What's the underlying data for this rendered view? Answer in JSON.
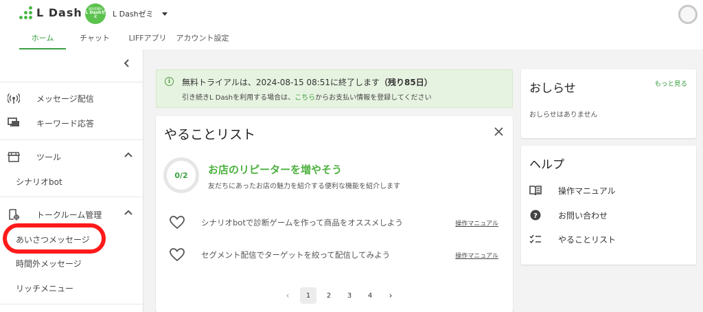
{
  "header": {
    "logo_text": "L Dash",
    "account": {
      "avatar_line1": "部田会場の",
      "avatar_line2": "L Dashゼミ",
      "name": "L Dashゼミ"
    },
    "tabs": [
      {
        "label": "ホーム",
        "active": true
      },
      {
        "label": "チャット",
        "active": false
      },
      {
        "label": "LIFFアプリ",
        "active": false
      },
      {
        "label": "アカウント設定",
        "active": false
      }
    ]
  },
  "sidebar": {
    "collapse_icon": "chevron-left-icon",
    "items": [
      {
        "label": "メッセージ配信",
        "icon": "broadcast-icon"
      },
      {
        "label": "キーワード応答",
        "icon": "chat-bubble-icon"
      }
    ],
    "tool_section": {
      "label": "ツール",
      "icon": "store-icon",
      "sub_items": [
        "シナリオbot"
      ]
    },
    "talkroom_section": {
      "label": "トークルーム管理",
      "icon": "room-settings-icon",
      "sub_items": [
        "あいさつメッセージ",
        "時間外メッセージ",
        "リッチメニュー"
      ]
    }
  },
  "trial": {
    "prefix": "無料トライアルは、2024-08-15 08:51に終了します",
    "remaining": "（残り85日）",
    "line2_before": "引き続きL Dashを利用する場合は、",
    "line2_link": "こちら",
    "line2_after": "からお支払い情報を登録してください"
  },
  "todo": {
    "title": "やることリスト",
    "progress": "0/2",
    "goal_title": "お店のリピーターを増やそう",
    "goal_subtitle": "友だちにあったお店の魅力を紹介する便利な機能を紹介します",
    "tasks": [
      {
        "text": "シナリオbotで診断ゲームを作って商品をオススメしよう",
        "manual": "操作マニュアル"
      },
      {
        "text": "セグメント配信でターゲットを絞って配信してみよう",
        "manual": "操作マニュアル"
      }
    ],
    "pagination": {
      "pages": [
        "1",
        "2",
        "3",
        "4"
      ],
      "current": "1",
      "prev": "‹",
      "next": "›"
    }
  },
  "news": {
    "title": "おしらせ",
    "more": "もっと見る",
    "empty": "おしらせはありません"
  },
  "help": {
    "title": "ヘルプ",
    "items": [
      {
        "label": "操作マニュアル",
        "icon": "book-icon"
      },
      {
        "label": "お問い合わせ",
        "icon": "question-icon"
      },
      {
        "label": "やることリスト",
        "icon": "checklist-icon"
      }
    ]
  },
  "colors": {
    "brand_green": "#3aa040",
    "highlight_red": "#ff1a1a",
    "trial_bg": "#e7f3e1"
  }
}
